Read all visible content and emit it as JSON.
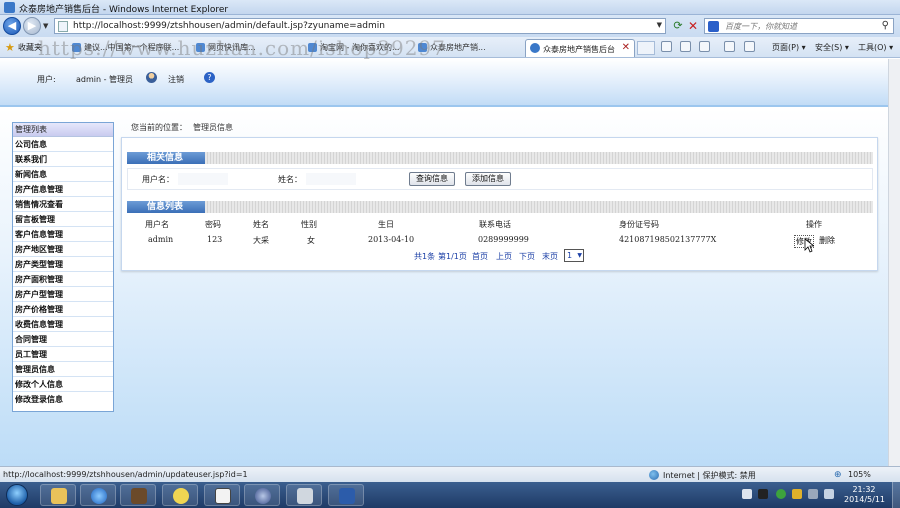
{
  "window": {
    "title": "众泰房地产销售后台 - Windows Internet Explorer"
  },
  "address": {
    "url": "http://localhost:9999/ztshhousen/admin/default.jsp?zyuname=admin",
    "search_placeholder": "百度一下，你就知道"
  },
  "favorites": {
    "label": "收藏夹",
    "items": [
      "建议...中国第一个程序联...",
      "网页快讯库...",
      "淘宝网 - 淘你喜欢的...",
      "众泰房地产销..."
    ]
  },
  "tab": {
    "label": "众泰房地产销售后台"
  },
  "commands": {
    "page": "页面(P) ▾",
    "safety": "安全(S) ▾",
    "tools": "工具(O) ▾"
  },
  "watermark": "https://www.huzhan.com/ishop39297",
  "header": {
    "user_label": "用户:",
    "user_name": "admin - 管理员",
    "logout": "注销"
  },
  "sidebar": {
    "title": "管理列表",
    "items": [
      "公司信息",
      "联系我们",
      "新闻信息",
      "房产信息管理",
      "销售情况查看",
      "留言板管理",
      "客户信息管理",
      "房产地区管理",
      "房产类型管理",
      "房产面积管理",
      "房产户型管理",
      "房产价格管理",
      "收费信息管理",
      "合同管理",
      "员工管理",
      "管理员信息",
      "修改个人信息",
      "修改登录信息"
    ]
  },
  "breadcrumb": {
    "prefix": "您当前的位置：",
    "current": "管理员信息"
  },
  "search_section": {
    "title": "相关信息",
    "username_label": "用户名：",
    "name_label": "姓名：",
    "query_button": "查询信息",
    "add_button": "添加信息"
  },
  "list_section": {
    "title": "信息列表",
    "columns": [
      "用户名",
      "密码",
      "姓名",
      "性别",
      "生日",
      "联系电话",
      "身份证号码",
      "操作"
    ],
    "rows": [
      {
        "username": "admin",
        "password": "123",
        "name": "大采",
        "gender": "女",
        "birthday": "2013-04-10",
        "phone": "0289999999",
        "id_card": "421087198502137777X",
        "edit": "修改",
        "delete": "删除"
      }
    ]
  },
  "pager": {
    "count": "共1条",
    "page_info": "第1/1页",
    "first": "首页",
    "prev": "上页",
    "next": "下页",
    "last": "末页",
    "current_page": "1"
  },
  "statusbar": {
    "url": "http://localhost:9999/ztshhousen/admin/updateuser.jsp?id=1",
    "zone": "Internet | 保护模式: 禁用",
    "zoom": "105%"
  },
  "taskbar": {
    "time": "21:32",
    "date": "2014/5/11"
  }
}
